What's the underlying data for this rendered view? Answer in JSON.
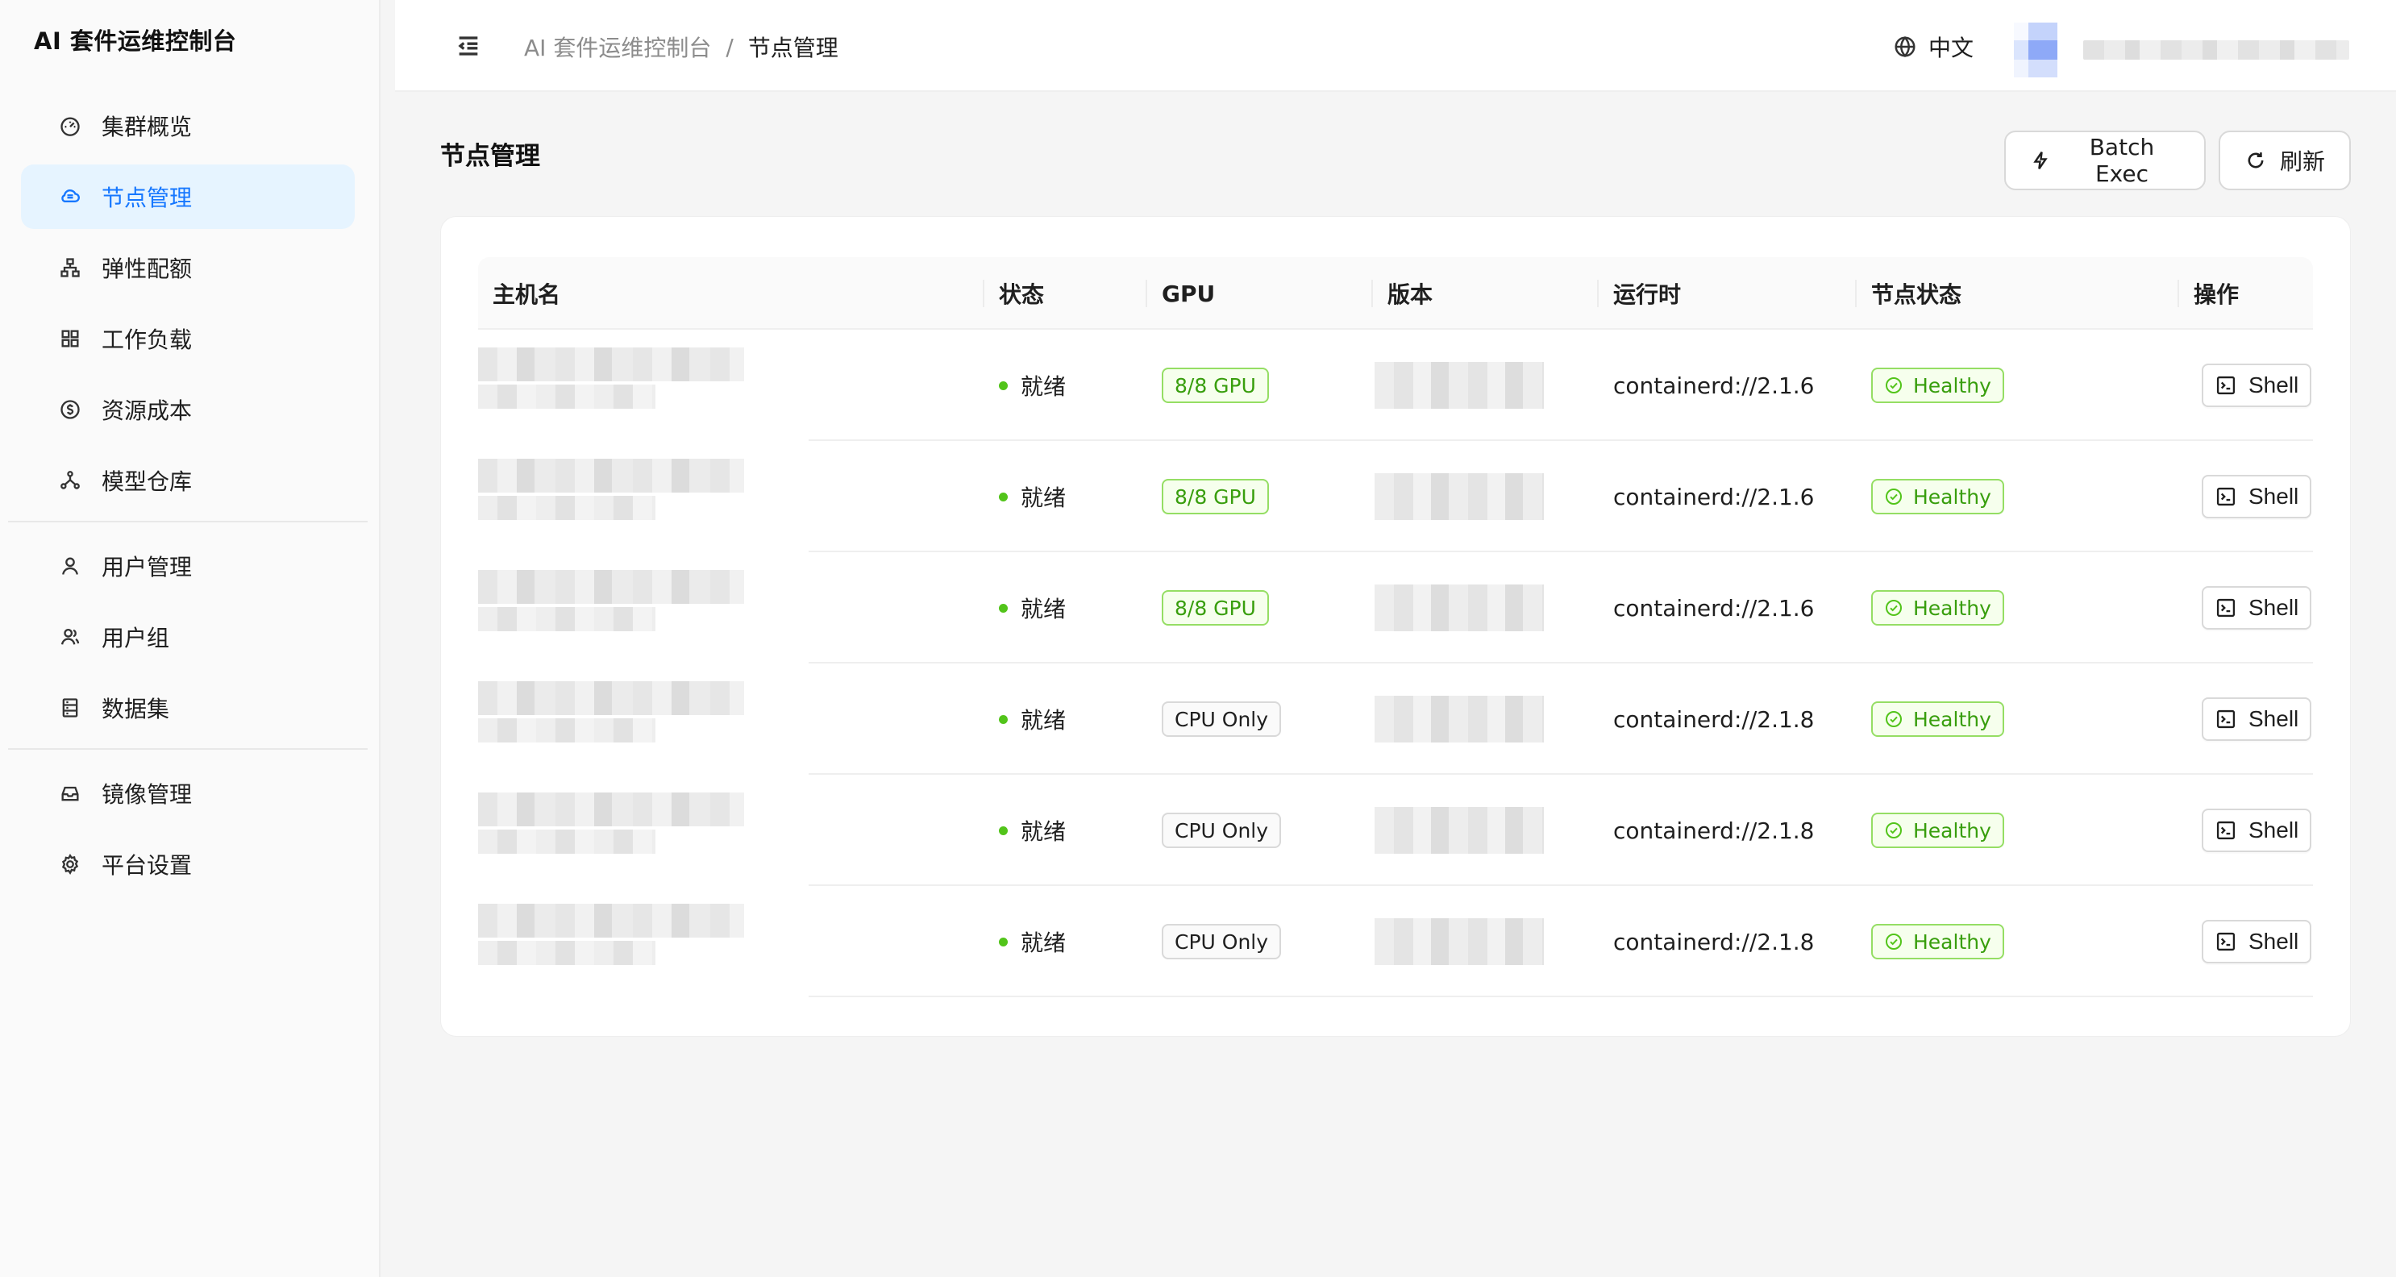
{
  "app": {
    "title": "AI 套件运维控制台"
  },
  "sidebar": {
    "items": [
      {
        "label": "集群概览",
        "icon": "dashboard-icon"
      },
      {
        "label": "节点管理",
        "icon": "cloud-icon",
        "active": true
      },
      {
        "label": "弹性配额",
        "icon": "cluster-icon"
      },
      {
        "label": "工作负载",
        "icon": "grid-icon"
      },
      {
        "label": "资源成本",
        "icon": "dollar-icon"
      },
      {
        "label": "模型仓库",
        "icon": "share-nodes-icon"
      },
      {
        "label": "用户管理",
        "icon": "user-icon"
      },
      {
        "label": "用户组",
        "icon": "usergroup-icon"
      },
      {
        "label": "数据集",
        "icon": "database-icon"
      },
      {
        "label": "镜像管理",
        "icon": "inbox-icon"
      },
      {
        "label": "平台设置",
        "icon": "gear-icon"
      }
    ]
  },
  "header": {
    "breadcrumb": {
      "root": "AI 套件运维控制台",
      "separator": "/",
      "current": "节点管理"
    },
    "language": "中文"
  },
  "page": {
    "title": "节点管理",
    "batch_exec_label": "Batch Exec",
    "refresh_label": "刷新"
  },
  "table": {
    "columns": [
      "主机名",
      "状态",
      "GPU",
      "版本",
      "运行时",
      "节点状态",
      "操作"
    ],
    "rows": [
      {
        "status": "就绪",
        "gpu": "8/8 GPU",
        "gpu_kind": "gpu",
        "runtime": "containerd://2.1.6",
        "health": "Healthy",
        "action": "Shell"
      },
      {
        "status": "就绪",
        "gpu": "8/8 GPU",
        "gpu_kind": "gpu",
        "runtime": "containerd://2.1.6",
        "health": "Healthy",
        "action": "Shell"
      },
      {
        "status": "就绪",
        "gpu": "8/8 GPU",
        "gpu_kind": "gpu",
        "runtime": "containerd://2.1.6",
        "health": "Healthy",
        "action": "Shell"
      },
      {
        "status": "就绪",
        "gpu": "CPU Only",
        "gpu_kind": "cpu",
        "runtime": "containerd://2.1.8",
        "health": "Healthy",
        "action": "Shell"
      },
      {
        "status": "就绪",
        "gpu": "CPU Only",
        "gpu_kind": "cpu",
        "runtime": "containerd://2.1.8",
        "health": "Healthy",
        "action": "Shell"
      },
      {
        "status": "就绪",
        "gpu": "CPU Only",
        "gpu_kind": "cpu",
        "runtime": "containerd://2.1.8",
        "health": "Healthy",
        "action": "Shell"
      }
    ]
  },
  "colors": {
    "accent": "#1677ff",
    "active_bg": "#e6f4ff",
    "success": "#52c41a",
    "success_text": "#389e0d"
  }
}
